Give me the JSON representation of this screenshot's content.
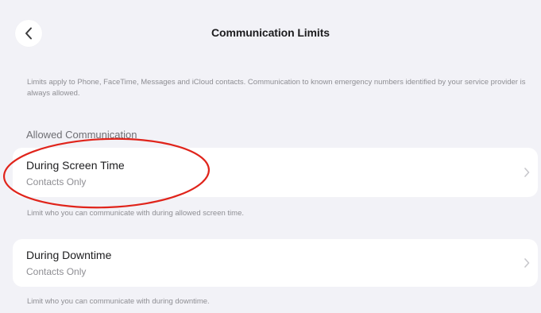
{
  "nav": {
    "title": "Communication Limits",
    "back_icon": "chevron-left-icon"
  },
  "intro_note": "Limits apply to Phone, FaceTime, Messages and iCloud contacts. Communication to known emergency numbers identified by your service provider is always allowed.",
  "section": {
    "header": "Allowed Communication"
  },
  "rows": [
    {
      "title": "During Screen Time",
      "subtitle": "Contacts Only",
      "footer": "Limit who you can communicate with during allowed screen time."
    },
    {
      "title": "During Downtime",
      "subtitle": "Contacts Only",
      "footer": "Limit who you can communicate with during downtime."
    }
  ],
  "colors": {
    "background": "#f2f2f7",
    "row_background": "#ffffff",
    "annotation_red": "#e0241b"
  }
}
